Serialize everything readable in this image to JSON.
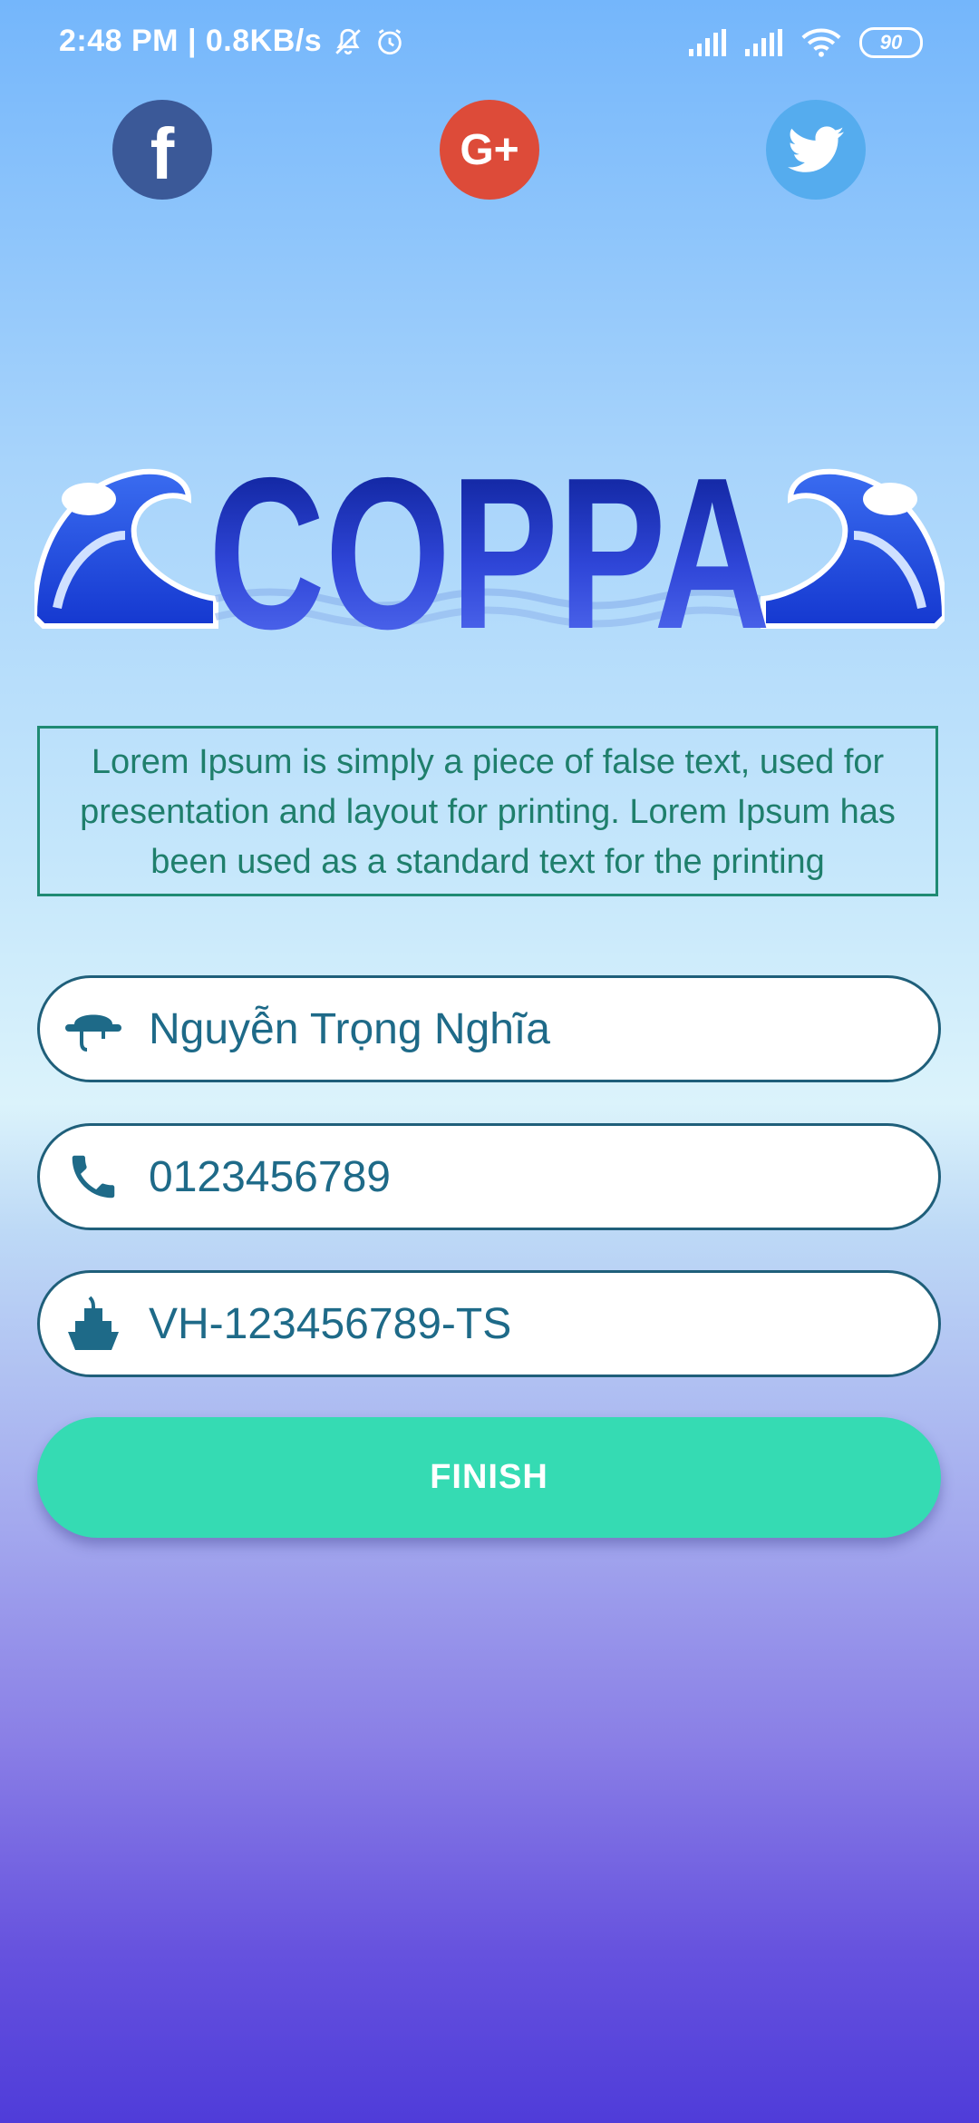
{
  "status_bar": {
    "time_speed": "2:48 PM | 0.8KB/s",
    "battery": "90"
  },
  "social": {
    "facebook_label": "f",
    "google_label": "G+"
  },
  "logo": {
    "text": "COPPA"
  },
  "description": "Lorem Ipsum is simply a piece of false text, used for presentation and layout for printing. Lorem Ipsum has been used as a standard text for the printing",
  "form": {
    "name_value": "Nguyễn Trọng Nghĩa",
    "phone_value": "0123456789",
    "vessel_value": "VH-123456789-TS",
    "finish_label": "FINISH"
  },
  "colors": {
    "accent": "#35dbb3",
    "field_text": "#1e6a88",
    "desc_border": "#1f8a73"
  }
}
